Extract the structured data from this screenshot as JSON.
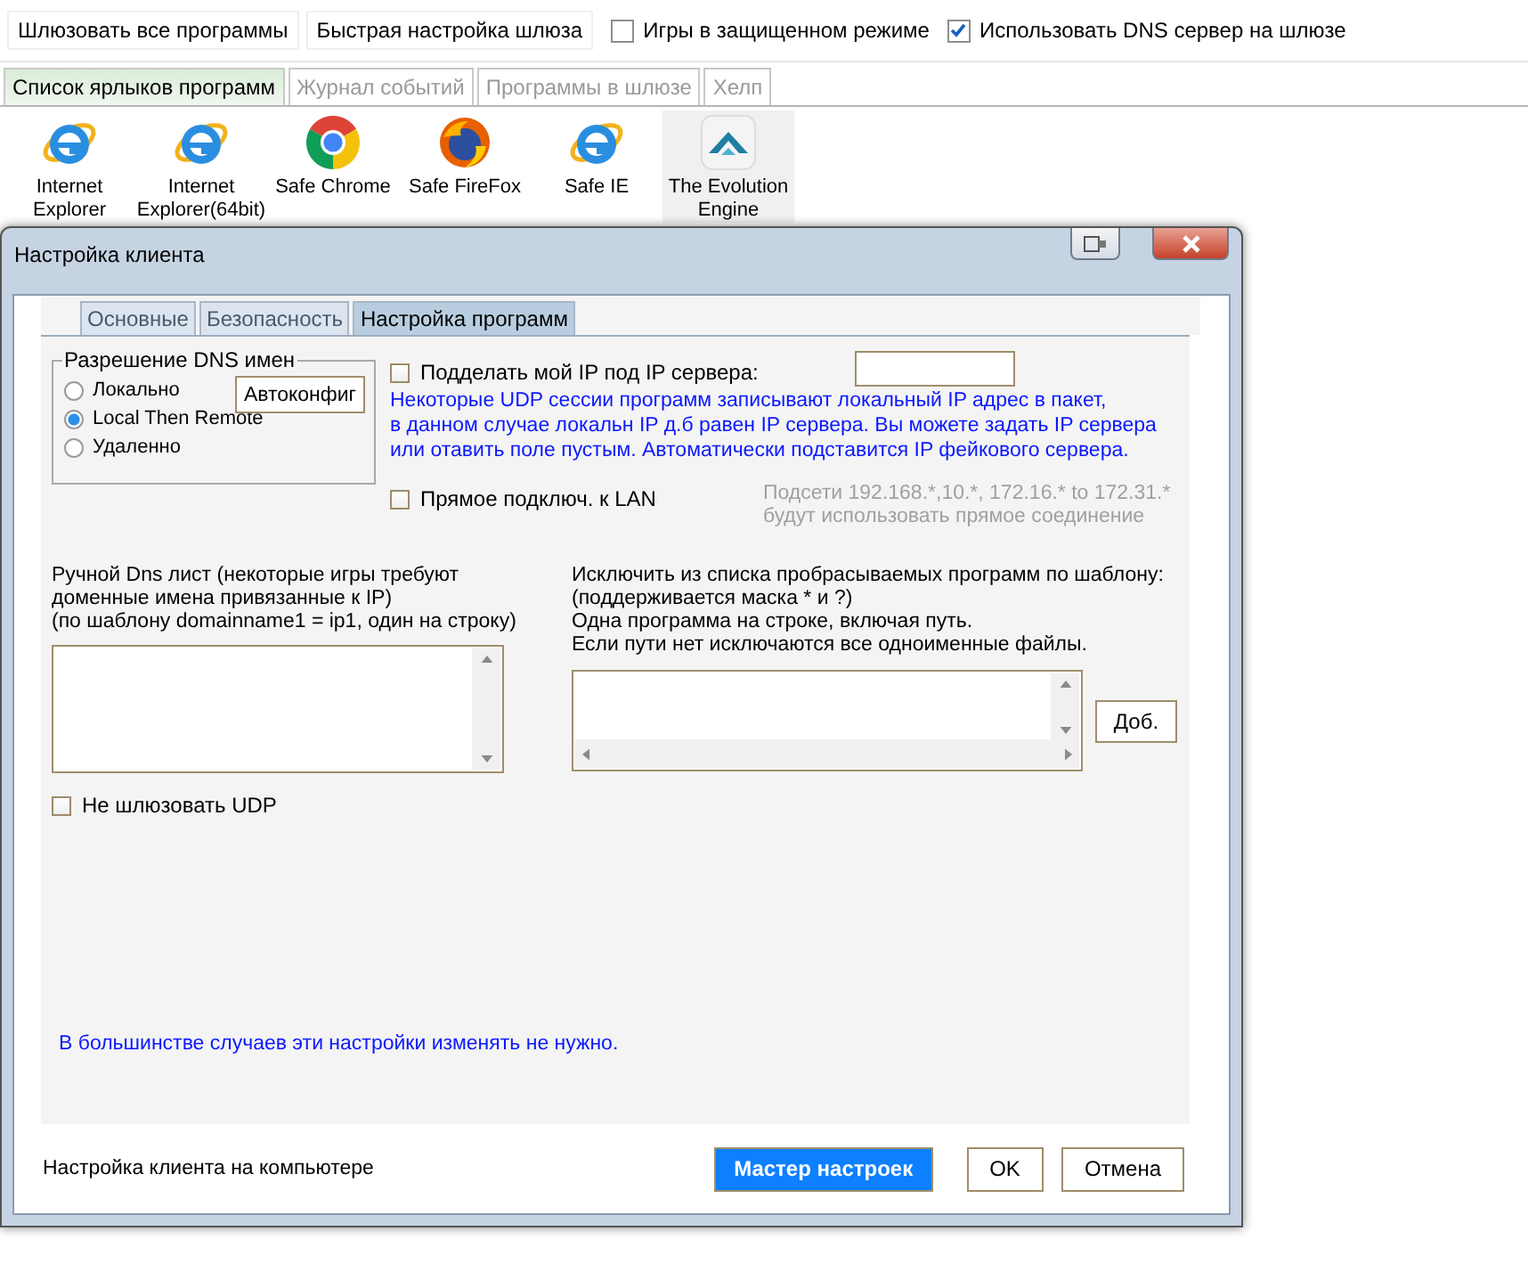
{
  "toolbar": [
    {
      "kind": "button",
      "label": "Шлюзовать все программы"
    },
    {
      "kind": "button",
      "label": "Быстрая настройка шлюза"
    },
    {
      "kind": "checkbox",
      "label": "Игры в защищенном режиме",
      "checked": false
    },
    {
      "kind": "checkbox",
      "label": "Использовать DNS сервер на шлюзе",
      "checked": true
    }
  ],
  "tabs": [
    {
      "label": "Список ярлыков программ",
      "selected": true
    },
    {
      "label": "Журнал событий",
      "selected": false
    },
    {
      "label": "Программы в шлюзе",
      "selected": false
    },
    {
      "label": "Хелп",
      "selected": false
    }
  ],
  "shortcuts": [
    {
      "kind": "ie",
      "label": "Internet Explorer",
      "selected": false
    },
    {
      "kind": "ie",
      "label": "Internet Explorer(64bit)",
      "selected": false
    },
    {
      "kind": "chrome",
      "label": "Safe Chrome",
      "selected": false
    },
    {
      "kind": "firefox",
      "label": "Safe FireFox",
      "selected": false
    },
    {
      "kind": "ie",
      "label": "Safe IE",
      "selected": false
    },
    {
      "kind": "engine",
      "label": "The Evolution Engine",
      "selected": true
    }
  ],
  "dialog": {
    "title": "Настройка клиента",
    "tabs": [
      {
        "label": "Основные",
        "selected": false
      },
      {
        "label": "Безопасность",
        "selected": false
      },
      {
        "label": "Настройка программ",
        "selected": true
      }
    ],
    "dns_group": {
      "title": "Разрешение DNS имен",
      "options": [
        {
          "label": "Локально",
          "selected": false
        },
        {
          "label": "Local Then Remote",
          "selected": true
        },
        {
          "label": "Удаленно",
          "selected": false
        }
      ],
      "autoconfig_button": "Автоконфиг"
    },
    "spoof_ip": {
      "label": "Подделать мой IP под IP сервера:",
      "checked": false
    },
    "spoof_note": "Некоторые UDP сессии программ записывают локальный IP адрес в пакет,\nв данном случае локальн IP д.б равен IP сервера. Вы можете задать IP сервера\nили отавить поле пустым. Автоматически подставится IP фейкового сервера.",
    "lan": {
      "label": "Прямое подключ. к LAN",
      "checked": false
    },
    "lan_note": "Подсети 192.168.*,10.*, 172.16.* to 172.31.*\nбудут использовать прямое соединение",
    "dns_list": {
      "label": "Ручной Dns лист (некоторые игры требуют\nдоменные имена привязанные к IP)\n(по шаблону domainname1 = ip1, один на строку)"
    },
    "exclude": {
      "label": "Исключить из списка пробрасываемых программ по шаблону:\n(поддерживается маска * и ?)\nОдна программа на строке, включая путь.\nЕсли пути нет исключаются все одноименные файлы.",
      "add_button": "Доб."
    },
    "no_udp": {
      "label": "Не шлюзовать UDP",
      "checked": false
    },
    "hint": "В большинстве случаев эти настройки изменять не нужно.",
    "status": "Настройка клиента на компьютере",
    "buttons": [
      {
        "kind": "primary",
        "label": "Мастер настроек"
      },
      {
        "kind": "normal",
        "label": "OK"
      },
      {
        "kind": "normal",
        "label": "Отмена"
      }
    ]
  }
}
